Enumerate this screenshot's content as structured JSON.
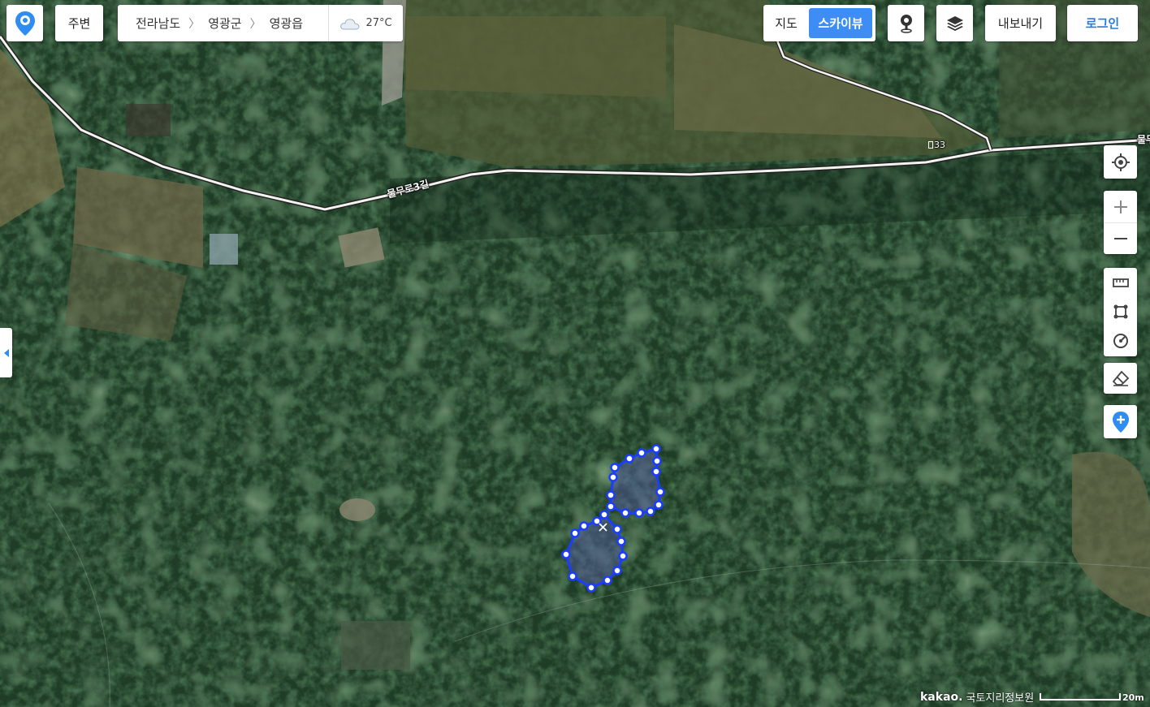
{
  "header": {
    "nearby_label": "주변",
    "breadcrumb": [
      "전라남도",
      "영광군",
      "영광읍"
    ],
    "weather_temp": "27°C",
    "weather_icon": "cloud-icon",
    "map_type_options": [
      "지도",
      "스카이뷰"
    ],
    "map_type_selected": "스카이뷰",
    "export_label": "내보내기",
    "login_label": "로그인"
  },
  "map": {
    "view": "skyview",
    "road_labels": [
      "물무로3길",
      "물무"
    ],
    "road_number": "33",
    "drawn_polygons": 2
  },
  "tools": {
    "icons": [
      "my-location-icon",
      "zoom-in-icon",
      "zoom-out-icon",
      "ruler-icon",
      "area-icon",
      "radius-icon",
      "eraser-icon",
      "add-marker-icon"
    ]
  },
  "footer": {
    "logo": "kakao.",
    "provider": "국토지리정보원",
    "scale": "20m"
  },
  "colors": {
    "accent": "#3e8df5",
    "polygon_stroke": "#1a3dff"
  }
}
